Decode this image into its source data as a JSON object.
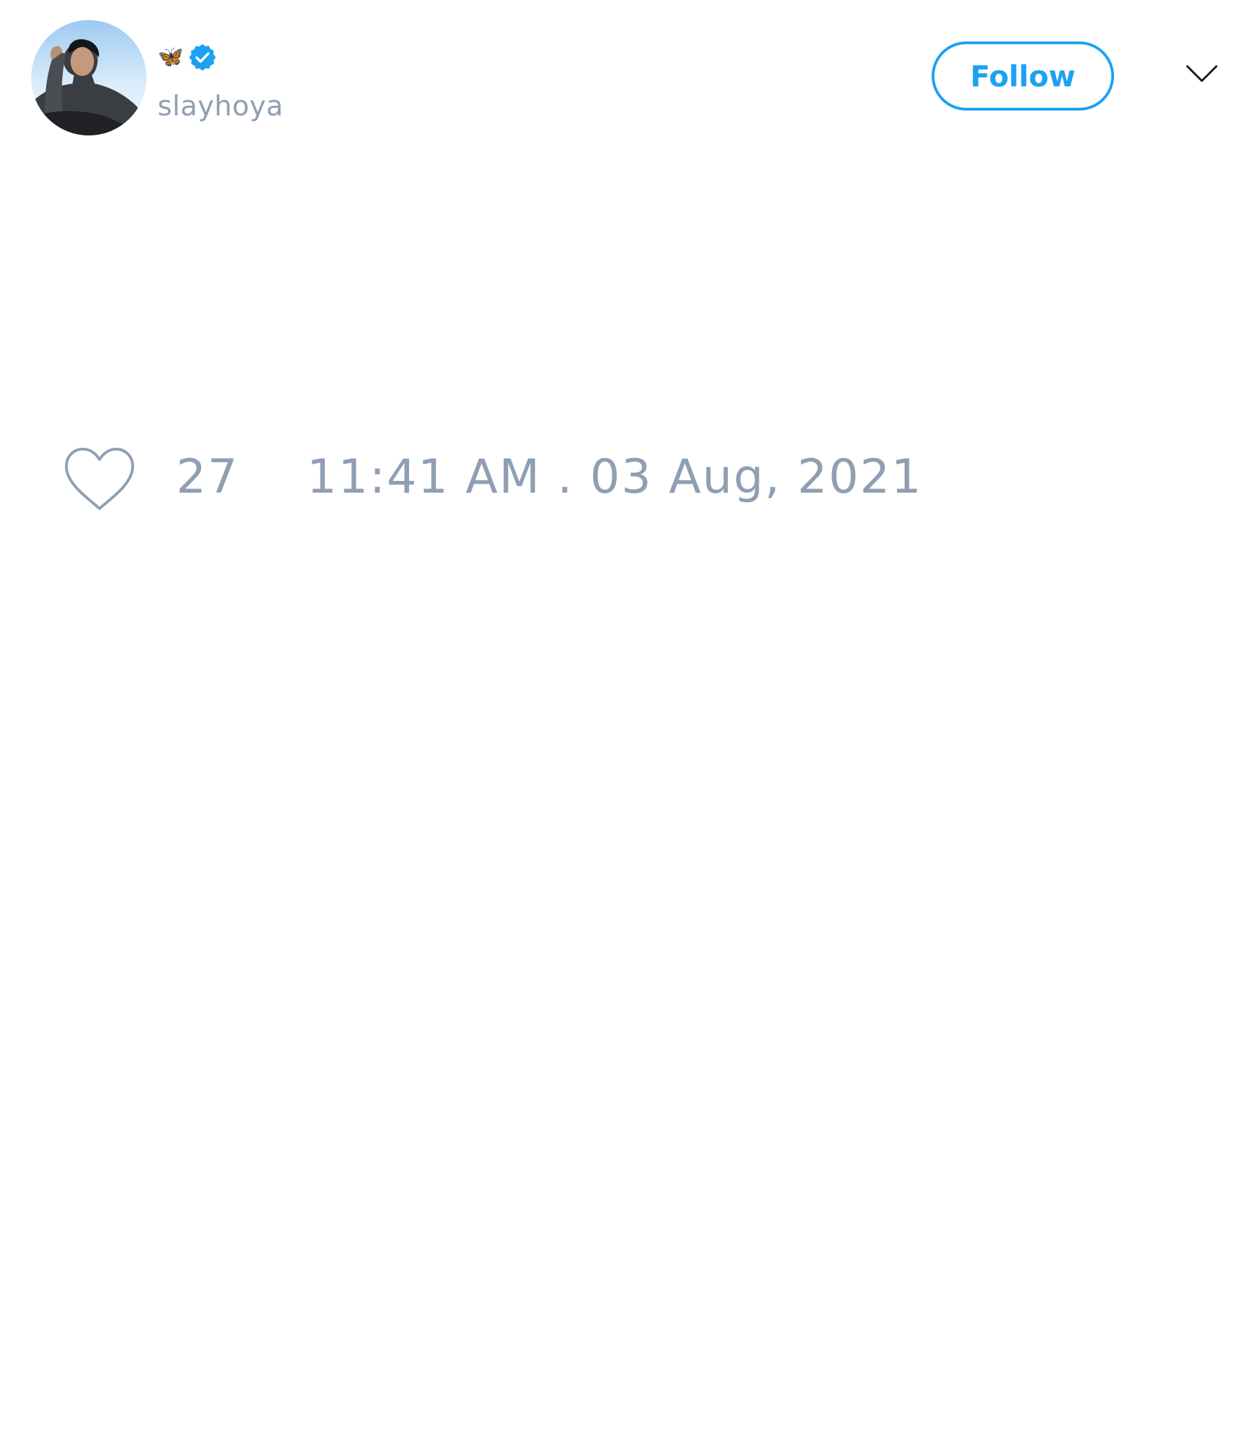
{
  "tweet": {
    "author": {
      "display_name_emoji": "🦋",
      "handle": "slayhoya",
      "verified": true,
      "avatar": "profile-photo"
    },
    "follow_label": "Follow",
    "menu_icon": "chevron-down-icon",
    "like_icon": "heart-icon",
    "like_count": "27",
    "timestamp": "11:41 AM . 03 Aug, 2021"
  },
  "colors": {
    "accent": "#1da1f2",
    "muted_text": "#8f9fb3",
    "background": "#ffffff"
  }
}
